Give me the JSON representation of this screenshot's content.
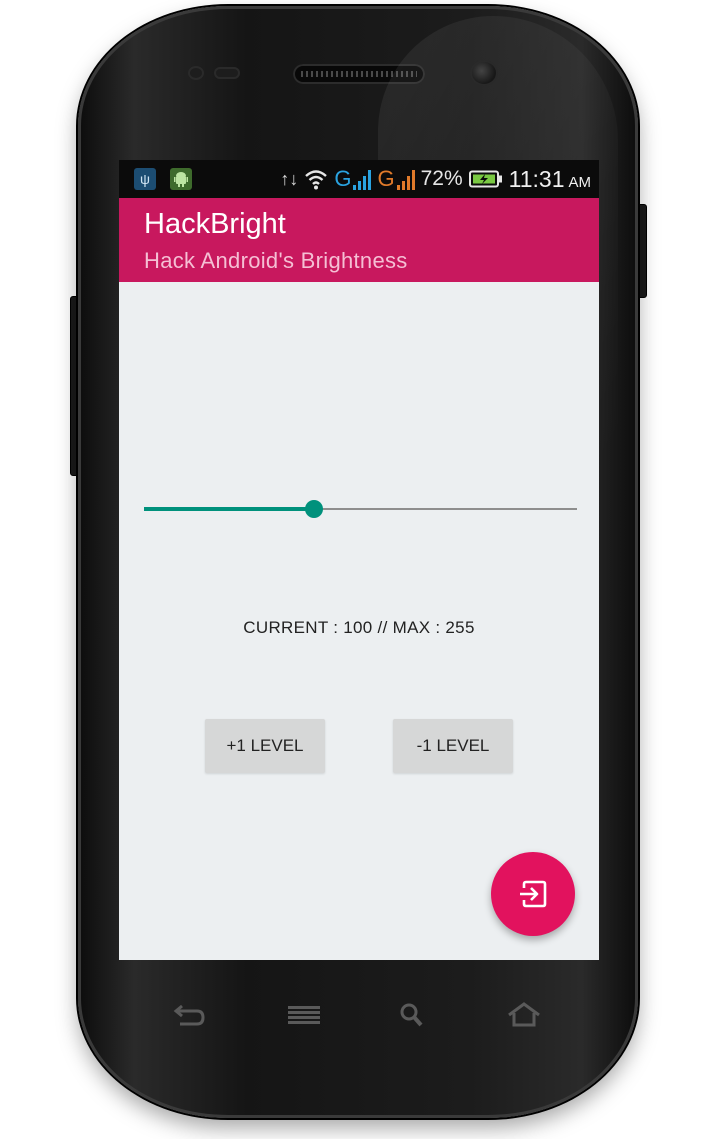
{
  "status_bar": {
    "notification_icons": [
      "usb-icon",
      "android-debug-icon"
    ],
    "network_type_1": "G",
    "network_type_2": "G",
    "battery_percent": "72%",
    "time": "11:31",
    "ampm": "AM",
    "colors": {
      "signal_1": "#2aa3e0",
      "signal_2": "#e07a2a",
      "battery_fill": "#7ac943"
    }
  },
  "app": {
    "title": "HackBright",
    "subtitle": "Hack Android's Brightness",
    "accent": "#c8185e",
    "fab_color": "#e2125e",
    "slider_color": "#00917c"
  },
  "brightness": {
    "current": 100,
    "max": 255,
    "readout": "CURRENT : 100 // MAX : 255"
  },
  "buttons": {
    "increase_label": "+1 LEVEL",
    "decrease_label": "-1 LEVEL",
    "fab_icon": "exit-to-app-icon"
  },
  "nav_keys": [
    "back-icon",
    "menu-icon",
    "search-icon",
    "home-icon"
  ]
}
